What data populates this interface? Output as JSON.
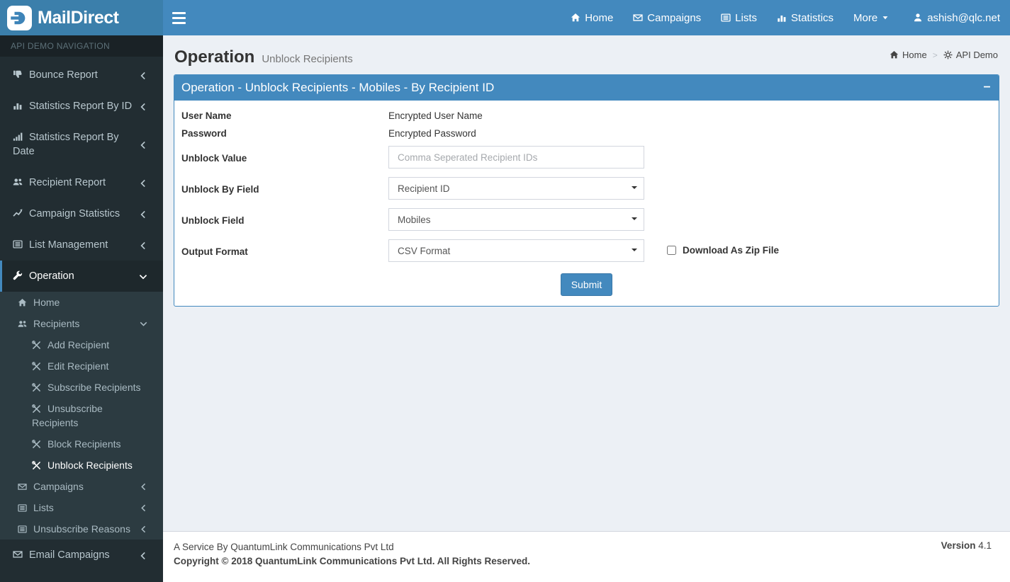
{
  "brand": {
    "name": "MailDirect"
  },
  "colors": {
    "navbar": "#4389be",
    "logo_bg": "#3b7fab",
    "accent": "#4389be",
    "sidebar_bg": "#222d32",
    "sidebar_submenu_bg": "#2c3b41",
    "content_bg": "#ecf0f5"
  },
  "topnav": {
    "items": [
      {
        "label": "Home",
        "icon": "home-icon"
      },
      {
        "label": "Campaigns",
        "icon": "envelope-icon"
      },
      {
        "label": "Lists",
        "icon": "list-icon"
      },
      {
        "label": "Statistics",
        "icon": "bar-chart-icon"
      },
      {
        "label": "More",
        "icon": null,
        "caret": true
      },
      {
        "label": "ashish@qlc.net",
        "icon": "user-icon"
      }
    ]
  },
  "sidebar": {
    "header": "API DEMO NAVIGATION",
    "items": [
      {
        "label": "Bounce Report",
        "icon": "thumbs-down-icon",
        "chevron": "left"
      },
      {
        "label": "Statistics Report By ID",
        "icon": "bar-chart-icon",
        "chevron": "left"
      },
      {
        "label": "Statistics Report By Date",
        "icon": "signal-icon",
        "chevron": "left"
      },
      {
        "label": "Recipient Report",
        "icon": "users-icon",
        "chevron": "left"
      },
      {
        "label": "Campaign Statistics",
        "icon": "line-chart-icon",
        "chevron": "left"
      },
      {
        "label": "List Management",
        "icon": "list-icon",
        "chevron": "left"
      },
      {
        "label": "Operation",
        "icon": "wrench-icon",
        "chevron": "down",
        "active": true,
        "expanded": true,
        "children": [
          {
            "label": "Home",
            "icon": "home-icon"
          },
          {
            "label": "Recipients",
            "icon": "users-icon",
            "chevron": "down",
            "expanded": true,
            "children": [
              {
                "label": "Add Recipient",
                "icon": "tools-icon"
              },
              {
                "label": "Edit Recipient",
                "icon": "tools-icon"
              },
              {
                "label": "Subscribe Recipients",
                "icon": "tools-icon"
              },
              {
                "label": "Unsubscribe Recipients",
                "icon": "tools-icon"
              },
              {
                "label": "Block Recipients",
                "icon": "tools-icon"
              },
              {
                "label": "Unblock Recipients",
                "icon": "tools-icon",
                "active": true
              }
            ]
          },
          {
            "label": "Campaigns",
            "icon": "envelope-icon",
            "chevron": "left"
          },
          {
            "label": "Lists",
            "icon": "list-icon",
            "chevron": "left"
          },
          {
            "label": "Unsubscribe Reasons",
            "icon": "list-icon",
            "chevron": "left"
          }
        ]
      },
      {
        "label": "Email Campaigns",
        "icon": "envelope-icon",
        "chevron": "left"
      }
    ]
  },
  "page": {
    "title": "Operation",
    "subtitle": "Unblock Recipients",
    "breadcrumb": [
      {
        "label": "Home",
        "icon": "home-icon"
      },
      {
        "label": "API Demo",
        "icon": "gear-icon"
      }
    ]
  },
  "panel": {
    "title": "Operation - Unblock Recipients - Mobiles - By Recipient ID"
  },
  "form": {
    "user_name": {
      "label": "User Name",
      "value": "Encrypted User Name"
    },
    "password": {
      "label": "Password",
      "value": "Encrypted Password"
    },
    "unblock_value": {
      "label": "Unblock Value",
      "value": "",
      "placeholder": "Comma Seperated Recipient IDs"
    },
    "unblock_by_field": {
      "label": "Unblock By Field",
      "selected": "Recipient ID"
    },
    "unblock_field": {
      "label": "Unblock Field",
      "selected": "Mobiles"
    },
    "output_format": {
      "label": "Output Format",
      "selected": "CSV Format"
    },
    "download_zip": {
      "label": "Download As Zip File",
      "checked": false
    },
    "submit_label": "Submit"
  },
  "footer": {
    "service_line": "A Service By QuantumLink Communications Pvt Ltd",
    "copyright_line": "Copyright © 2018 QuantumLink Communications Pvt Ltd. All Rights Reserved.",
    "version_label": "Version",
    "version_value": "4.1"
  }
}
